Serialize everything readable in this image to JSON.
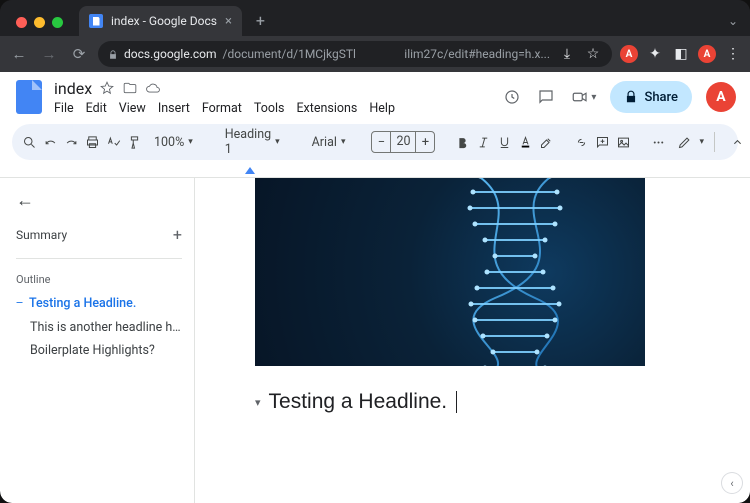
{
  "browser": {
    "tab_title": "index - Google Docs",
    "url_host": "docs.google.com",
    "url_path": "/document/d/1MCjkgSTl",
    "url_suffix": "ilim27c/edit#heading=h.x...",
    "traffic": {
      "close": "close-window",
      "min": "minimize-window",
      "max": "maximize-window"
    }
  },
  "header": {
    "doc_title": "index",
    "menus": [
      "File",
      "Edit",
      "View",
      "Insert",
      "Format",
      "Tools",
      "Extensions",
      "Help"
    ],
    "share_label": "Share",
    "avatar_initial": "A"
  },
  "toolbar": {
    "zoom": "100%",
    "style": "Heading 1",
    "font": "Arial",
    "fontsize": "20"
  },
  "sidebar": {
    "summary_label": "Summary",
    "outline_label": "Outline",
    "items": [
      {
        "label": "Testing a Headline.",
        "active": true
      },
      {
        "label": "This is another headline here f...",
        "active": false
      },
      {
        "label": "Boilerplate Highlights?",
        "active": false
      }
    ]
  },
  "document": {
    "hero_alt": "dna-helix-image",
    "headline_text": "Testing a Headline."
  }
}
